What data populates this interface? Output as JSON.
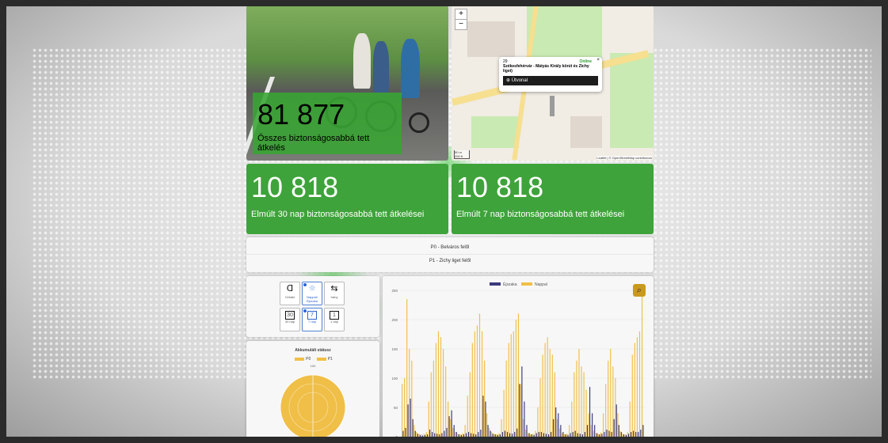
{
  "stats": {
    "total": {
      "value": "81 877",
      "label": "Összes biztonságosabbá tett átkelés"
    },
    "last30": {
      "value": "10 818",
      "label": "Elmúlt 30 nap biztonságosabbá tett átkelései"
    },
    "last7": {
      "value": "10 818",
      "label": "Elmúlt 7 nap biztonságosabbá tett átkelései"
    }
  },
  "map": {
    "zoom_in": "+",
    "zoom_out": "−",
    "popup": {
      "id": "29",
      "status": "Online",
      "title": "Székesfehérvár - Mátyás Király körút és Zichy liget)",
      "route_label": "Útvonal"
    },
    "scale": {
      "metric": "50 m",
      "imperial": "200 ft"
    },
    "attribution": "Leaflet | © OpenStreetMap contributors"
  },
  "directions": [
    "P0 - Belváros felől",
    "P1 - Zichy liget felől"
  ],
  "controls": [
    {
      "icon": "cyclist-icon",
      "glyph": "ᗡ",
      "label": "Cirkáló",
      "active": false
    },
    {
      "icon": "day-night-icon",
      "glyph": "☼",
      "label": "Nappal/ Éjszaka",
      "active": true
    },
    {
      "icon": "direction-icon",
      "glyph": "⇆",
      "label": "Irány",
      "active": false
    },
    {
      "icon": "30-days-icon",
      "glyph": "30",
      "label": "30 nap",
      "active": false
    },
    {
      "icon": "7-days-icon",
      "glyph": "7",
      "label": "7 nap",
      "active": true
    },
    {
      "icon": "1-day-icon",
      "glyph": "1",
      "label": "1 nap",
      "active": false
    }
  ],
  "accumulated": {
    "title": "Akkumulált státusz",
    "legend": [
      "P0",
      "P1"
    ],
    "top_value": "100",
    "color": "#f0bf48"
  },
  "chart_data": {
    "type": "bar",
    "legend": [
      {
        "name": "Éjszaka",
        "color": "#3b3a7d"
      },
      {
        "name": "Nappal",
        "color": "#f0bf48"
      }
    ],
    "yticks": [
      0,
      50,
      100,
      150,
      200,
      250
    ],
    "ylim": [
      0,
      250
    ],
    "grid": true,
    "series": [
      {
        "name": "Nappal",
        "values": [
          90,
          100,
          235,
          150,
          130,
          20,
          8,
          5,
          4,
          5,
          8,
          60,
          110,
          130,
          160,
          180,
          170,
          150,
          120,
          60,
          30,
          15,
          8,
          5,
          4,
          6,
          20,
          70,
          110,
          160,
          180,
          190,
          210,
          180,
          130,
          40,
          15,
          8,
          5,
          4,
          6,
          30,
          80,
          130,
          160,
          175,
          180,
          200,
          210,
          90,
          30,
          12,
          6,
          4,
          5,
          10,
          50,
          100,
          140,
          160,
          170,
          150,
          140,
          110,
          30,
          14,
          6,
          4,
          5,
          20,
          60,
          110,
          130,
          150,
          120,
          110,
          80,
          40,
          20,
          10,
          6,
          4,
          7,
          40,
          90,
          130,
          150,
          120,
          100,
          40,
          10,
          5,
          4,
          8,
          60,
          140,
          160,
          170,
          180,
          240
        ]
      },
      {
        "name": "Éjszaka",
        "values": [
          10,
          15,
          55,
          65,
          30,
          10,
          5,
          3,
          2,
          3,
          4,
          12,
          8,
          6,
          5,
          4,
          6,
          10,
          15,
          35,
          45,
          20,
          8,
          4,
          3,
          4,
          6,
          8,
          6,
          5,
          4,
          8,
          12,
          70,
          60,
          20,
          10,
          5,
          4,
          3,
          4,
          8,
          10,
          8,
          6,
          5,
          8,
          14,
          90,
          120,
          60,
          20,
          6,
          4,
          3,
          6,
          8,
          8,
          6,
          5,
          4,
          8,
          30,
          50,
          40,
          20,
          8,
          4,
          3,
          6,
          8,
          10,
          6,
          5,
          4,
          8,
          20,
          85,
          40,
          20,
          6,
          4,
          5,
          8,
          12,
          10,
          8,
          30,
          55,
          20,
          8,
          4,
          3,
          5,
          8,
          10,
          8,
          8,
          12,
          20
        ]
      }
    ]
  }
}
